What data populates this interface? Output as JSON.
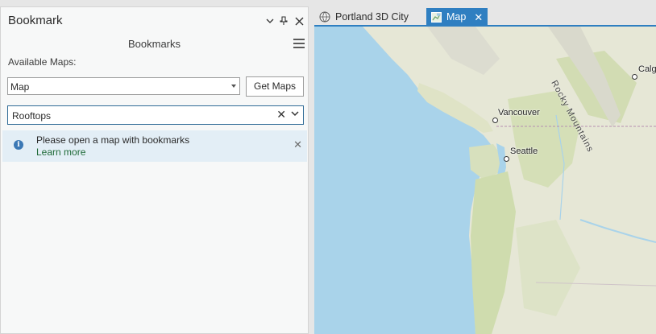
{
  "pane": {
    "title": "Bookmark",
    "heading": "Bookmarks",
    "available_label": "Available Maps:",
    "map_select_value": "Map",
    "get_maps_label": "Get Maps",
    "bookmark_combo_value": "Rooftops",
    "message": {
      "text": "Please open a map with bookmarks",
      "link": "Learn more"
    }
  },
  "tabs": [
    {
      "label": "Portland 3D City",
      "active": false
    },
    {
      "label": "Map",
      "active": true
    }
  ],
  "map": {
    "labels": {
      "vancouver": "Vancouver",
      "seattle": "Seattle",
      "calgary": "Calg",
      "rocky": "Rocky Mountains"
    }
  },
  "colors": {
    "accent": "#2f7fc1",
    "water": "#a9d3ea",
    "link": "#1f6a38",
    "info": "#3b78b5"
  }
}
